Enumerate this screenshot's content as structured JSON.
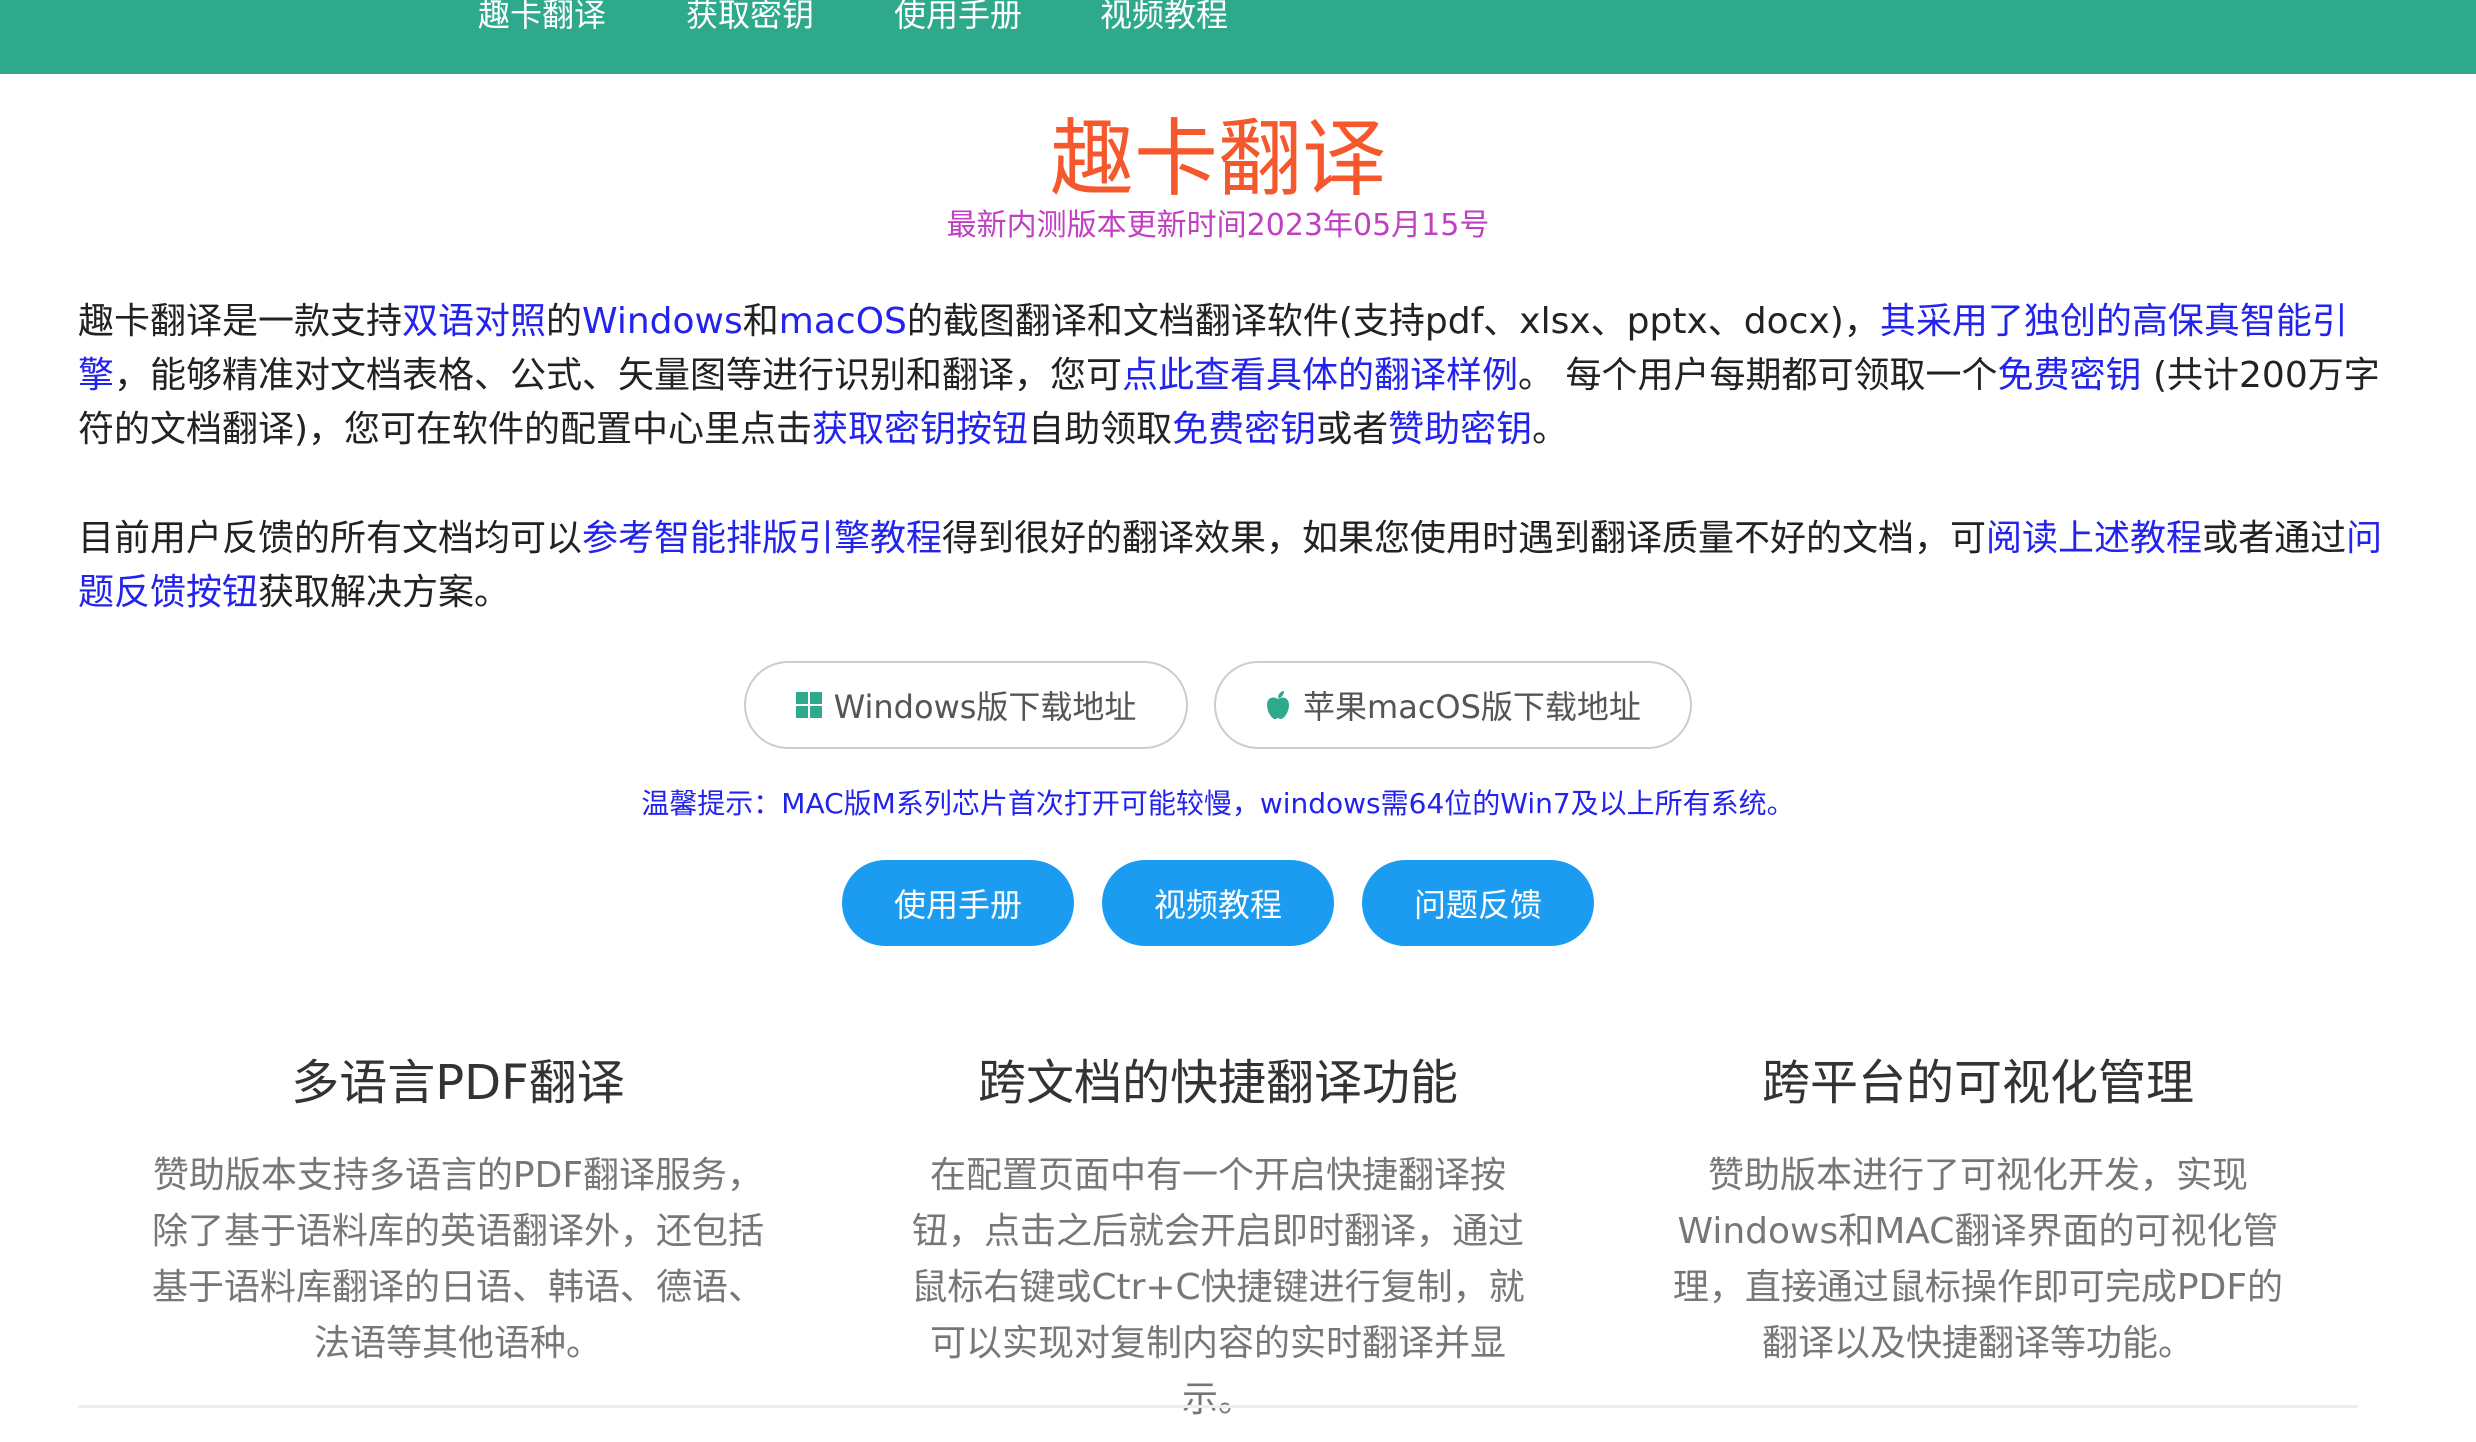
{
  "nav": {
    "items": [
      "趣卡翻译",
      "获取密钥",
      "使用手册",
      "视频教程"
    ]
  },
  "header": {
    "title": "趣卡翻译",
    "subtitle": "最新内测版本更新时间2023年05月15号"
  },
  "intro": {
    "t1": "趣卡翻译是一款支持",
    "l1": "双语对照",
    "t2": "的",
    "l2": "Windows",
    "t3": "和",
    "l3": "macOS",
    "t4": "的截图翻译和文档翻译软件(支持pdf、xlsx、pptx、docx)，",
    "l4": "其采用了独创的高保真智能引擎",
    "t5": "，能够精准对文档表格、公式、矢量图等进行识别和翻译，您可",
    "l5": "点此查看具体的翻译样例",
    "t6": "。 每个用户每期都可领取一个",
    "l6": "免费密钥",
    "t7": " (共计200万字符的文档翻译)，您可在软件的配置中心里点击",
    "l7": "获取密钥按钮",
    "t8": "自助领取",
    "l8": "免费密钥",
    "t9": "或者",
    "l9": "赞助密钥",
    "t10": "。"
  },
  "feedback": {
    "t1": "目前用户反馈的所有文档均可以",
    "l1": "参考智能排版引擎教程",
    "t2": "得到很好的翻译效果，如果您使用时遇到翻译质量不好的文档，可",
    "l2": "阅读上述教程",
    "t3": "或者通过",
    "l3": "问题反馈按钮",
    "t4": "获取解决方案。"
  },
  "downloads": {
    "windows_label": "Windows版下载地址",
    "windows_icon": "windows-logo-icon",
    "mac_label": "苹果macOS版下载地址",
    "mac_icon": "apple-logo-icon",
    "windows_icon_color": "#2fa98c",
    "mac_icon_color": "#2fa98c"
  },
  "tip": "温馨提示：MAC版M系列芯片首次打开可能较慢，windows需64位的Win7及以上所有系统。",
  "actions": [
    "使用手册",
    "视频教程",
    "问题反馈"
  ],
  "features": [
    {
      "title": "多语言PDF翻译",
      "desc": "赞助版本支持多语言的PDF翻译服务，除了基于语料库的英语翻译外，还包括基于语料库翻译的日语、韩语、德语、法语等其他语种。"
    },
    {
      "title": "跨文档的快捷翻译功能",
      "desc": "在配置页面中有一个开启快捷翻译按钮，点击之后就会开启即时翻译，通过鼠标右键或Ctr+C快捷键进行复制，就可以实现对复制内容的实时翻译并显示。"
    },
    {
      "title": "跨平台的可视化管理",
      "desc": "赞助版本进行了可视化开发，实现Windows和MAC翻译界面的可视化管理，直接通过鼠标操作即可完成PDF的翻译以及快捷翻译等功能。"
    }
  ],
  "colors": {
    "nav_bg": "#2fa98c",
    "title": "#f4582c",
    "subtitle": "#c13fc3",
    "link": "#2323ee",
    "pill": "#1c9cf0"
  }
}
